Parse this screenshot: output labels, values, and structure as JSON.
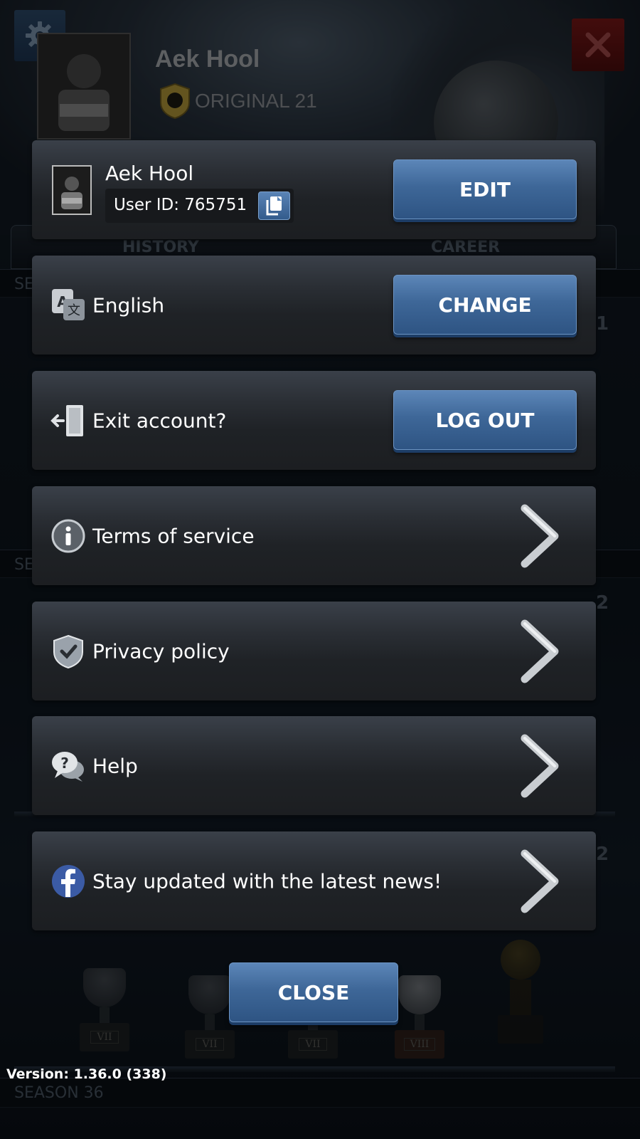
{
  "background": {
    "player_name": "Aek Hool",
    "team_name": "ORIGINAL 21",
    "tabs": [
      "HISTORY",
      "CAREER"
    ],
    "seasons": [
      {
        "label": "SE"
      },
      {
        "label": "SE"
      },
      {
        "label": "SEASON 36"
      }
    ],
    "ranks": [
      "1",
      "2",
      "2"
    ],
    "trophy_labels": [
      "VII",
      "VII",
      "VII",
      "VIII"
    ],
    "partial_team_text": "ORIGINAL 21"
  },
  "profile": {
    "name": "Aek Hool",
    "user_id_text": "User ID: 765751",
    "edit_label": "EDIT"
  },
  "language": {
    "label": "English",
    "button_label": "CHANGE"
  },
  "account": {
    "label": "Exit account?",
    "button_label": "LOG OUT"
  },
  "links": [
    {
      "label": "Terms of service",
      "icon": "info-icon"
    },
    {
      "label": "Privacy policy",
      "icon": "shield-check-icon"
    },
    {
      "label": "Help",
      "icon": "help-bubble-icon"
    },
    {
      "label": "Stay updated with the latest news!",
      "icon": "facebook-icon"
    }
  ],
  "close_label": "CLOSE",
  "version_text": "Version: 1.36.0 (338)",
  "colors": {
    "button_blue": "#3e6798",
    "panel_dark": "#1f2226",
    "facebook_blue": "#3b5ba5"
  }
}
